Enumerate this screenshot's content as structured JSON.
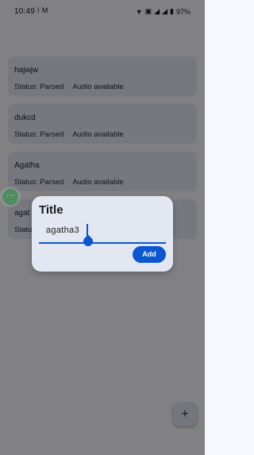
{
  "status_bar": {
    "time": "10:49",
    "left_icons": [
      "wifi-calling-icon",
      "gmail-icon"
    ],
    "battery": "97%"
  },
  "recordings": [
    {
      "title": "hajwjw",
      "status": "Status: Parsed",
      "audio": "Audio available"
    },
    {
      "title": "dukcd",
      "status": "Status: Parsed",
      "audio": "Audio available"
    },
    {
      "title": "Agatha",
      "status": "Status: Parsed",
      "audio": "Audio available"
    },
    {
      "title": "agat",
      "status": "Statu",
      "audio": ""
    }
  ],
  "dialog": {
    "title": "Title",
    "input_value": "agatha3",
    "add_label": "Add"
  },
  "fab_label": "+",
  "colors": {
    "accent": "#0b57d0",
    "card": "#e2e6f2",
    "dialog": "#e3e7f2"
  }
}
